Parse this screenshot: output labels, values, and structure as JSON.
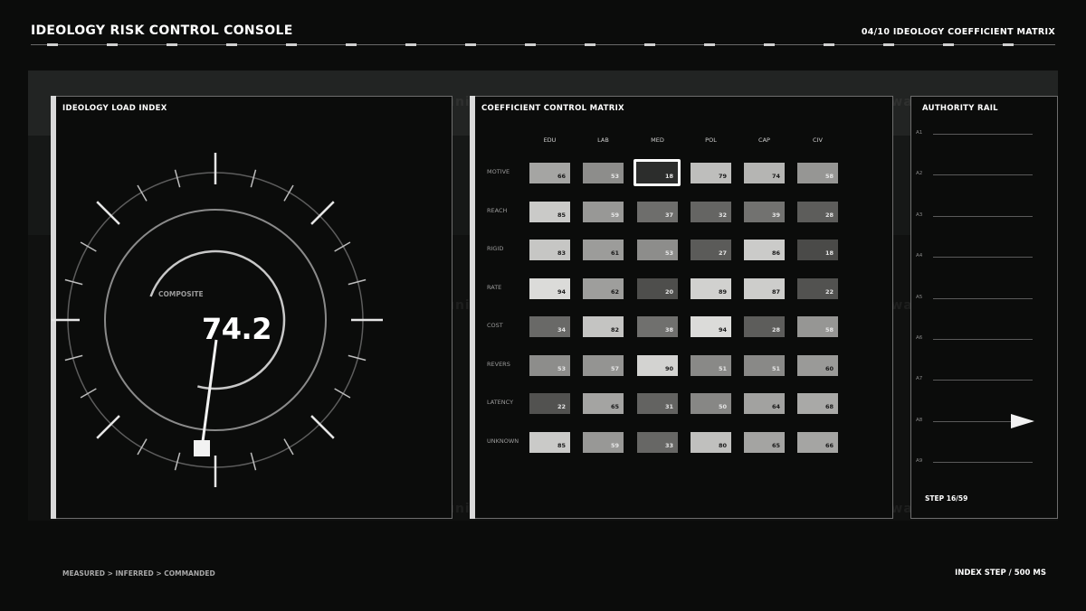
{
  "header": {
    "title": "IDEOLOGY RISK CONTROL CONSOLE",
    "right": "04/10  IDEOLOGY COEFFICIENT MATRIX"
  },
  "watermark": "uniquelivewallpaper.com",
  "gauge": {
    "title": "IDEOLOGY LOAD INDEX",
    "label": "COMPOSITE",
    "value": "74.2"
  },
  "matrix": {
    "title": "COEFFICIENT CONTROL MATRIX",
    "columns": [
      "EDU",
      "LAB",
      "MED",
      "POL",
      "CAP",
      "CIV"
    ],
    "rows": [
      {
        "label": "MOTIVE",
        "values": [
          66,
          53,
          18,
          79,
          74,
          58
        ]
      },
      {
        "label": "REACH",
        "values": [
          85,
          59,
          37,
          32,
          39,
          28
        ]
      },
      {
        "label": "RIGID",
        "values": [
          83,
          61,
          53,
          27,
          86,
          18
        ]
      },
      {
        "label": "RATE",
        "values": [
          94,
          62,
          20,
          89,
          87,
          22
        ]
      },
      {
        "label": "COST",
        "values": [
          34,
          82,
          38,
          94,
          28,
          58
        ]
      },
      {
        "label": "REVERS",
        "values": [
          53,
          57,
          90,
          51,
          51,
          60
        ]
      },
      {
        "label": "LATENCY",
        "values": [
          22,
          65,
          31,
          50,
          64,
          68
        ]
      },
      {
        "label": "UNKNOWN",
        "values": [
          85,
          59,
          33,
          80,
          65,
          66
        ]
      }
    ],
    "selected": {
      "row": 0,
      "col": 2
    }
  },
  "rail": {
    "title": "AUTHORITY RAIL",
    "labels": [
      "A1",
      "A2",
      "A3",
      "A4",
      "A5",
      "A6",
      "A7",
      "A8",
      "A9"
    ],
    "marker_index": 7,
    "step": "STEP 16/59"
  },
  "footer": {
    "left": "MEASURED > INFERRED > COMMANDED",
    "right": "INDEX STEP / 500 MS"
  }
}
